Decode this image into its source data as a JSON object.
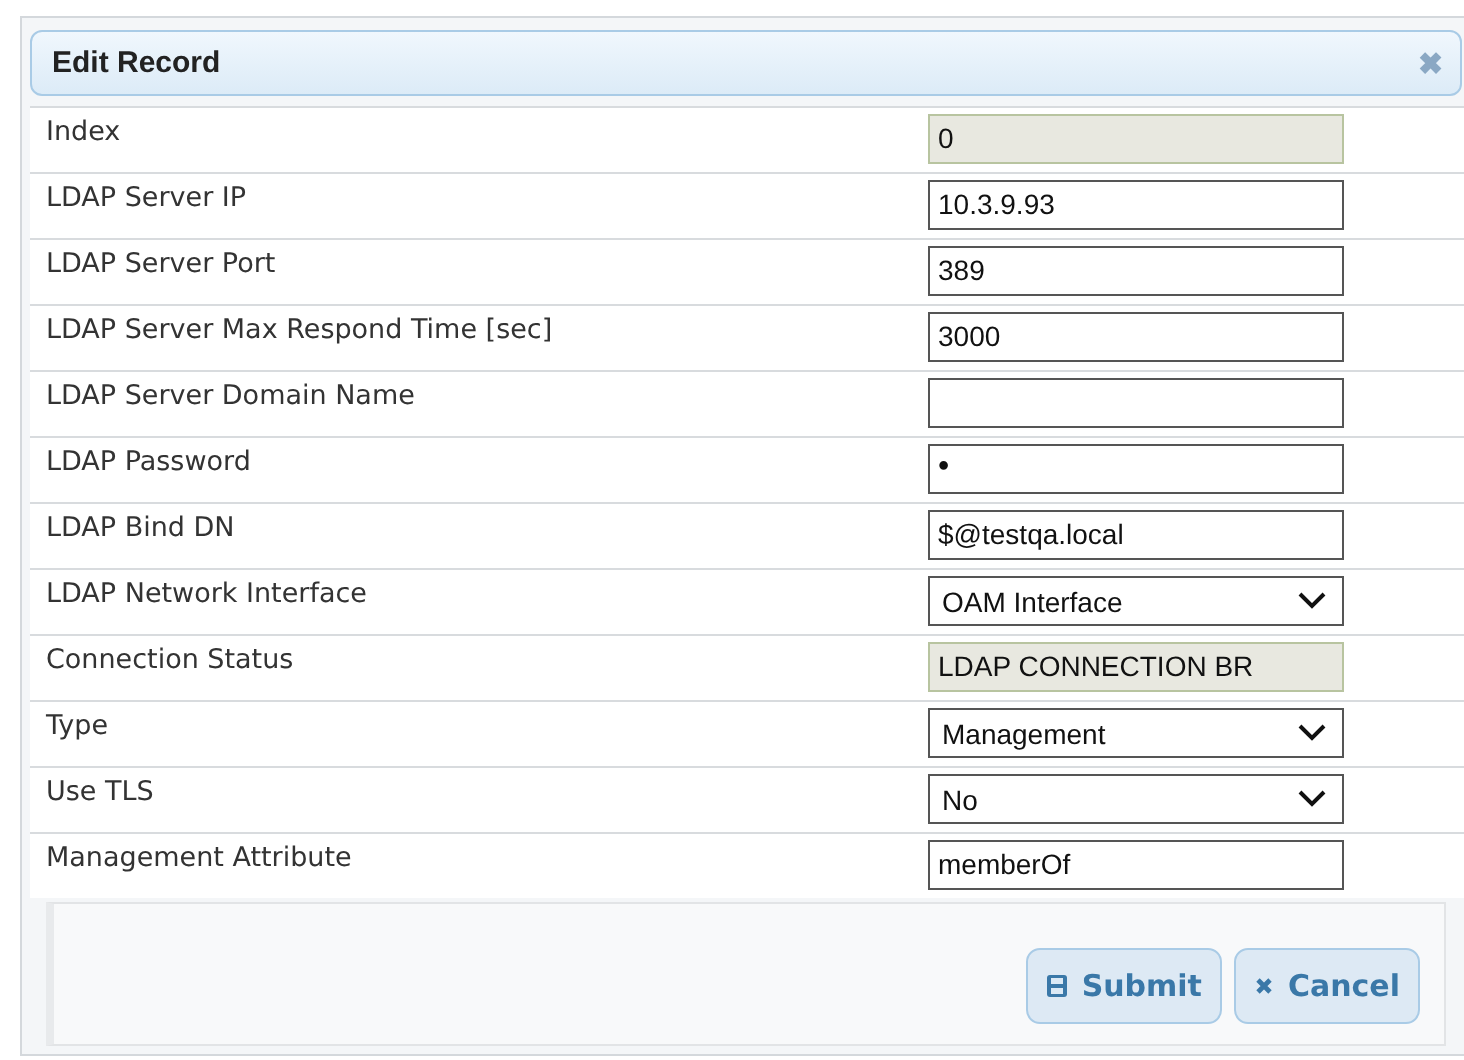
{
  "dialog": {
    "title": "Edit Record",
    "close": "✖"
  },
  "fields": [
    {
      "label": "Index",
      "kind": "readonly",
      "value": "0"
    },
    {
      "label": "LDAP Server IP",
      "kind": "text",
      "value": "10.3.9.93"
    },
    {
      "label": "LDAP Server Port",
      "kind": "text",
      "value": "389"
    },
    {
      "label": "LDAP Server Max Respond Time [sec]",
      "kind": "text",
      "value": "3000"
    },
    {
      "label": "LDAP Server Domain Name",
      "kind": "text"
    },
    {
      "label": "LDAP Password",
      "kind": "password",
      "value": "•"
    },
    {
      "label": "LDAP Bind DN",
      "kind": "text",
      "value": "$@testqa.local"
    },
    {
      "label": "LDAP Network Interface",
      "kind": "select",
      "value": "OAM Interface"
    },
    {
      "label": "Connection Status",
      "kind": "readonly",
      "value": "LDAP CONNECTION BR"
    },
    {
      "label": "Type",
      "kind": "select",
      "value": "Management"
    },
    {
      "label": "Use TLS",
      "kind": "select",
      "value": "No"
    },
    {
      "label": "Management Attribute",
      "kind": "text",
      "value": "memberOf"
    }
  ],
  "buttons": [
    {
      "label": "Submit",
      "kind": "submit"
    },
    {
      "label": "Cancel",
      "kind": "cancel"
    }
  ]
}
